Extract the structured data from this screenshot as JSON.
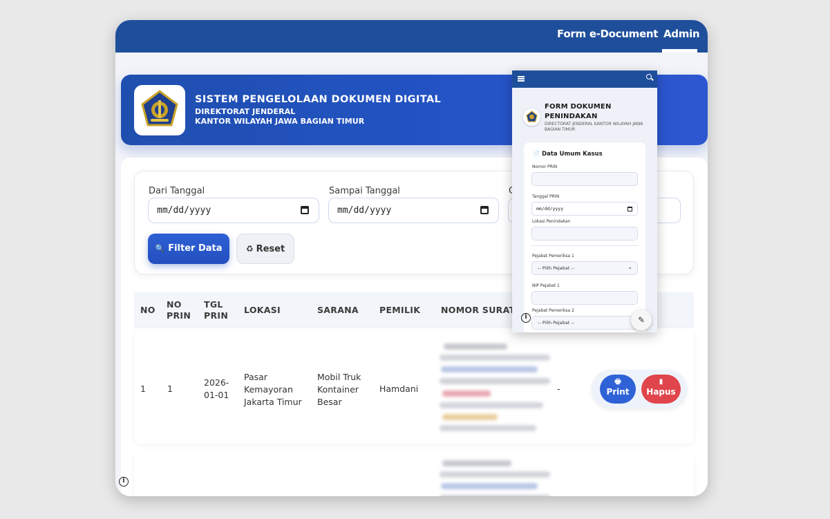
{
  "nav": {
    "form_link": "Form e-Document",
    "admin_link": "Admin"
  },
  "hero": {
    "title": "SISTEM PENGELOLAAN DOKUMEN DIGITAL",
    "subtitle_line1": "DIREKTORAT JENDERAL",
    "subtitle_line2": "KANTOR WILAYAH JAWA BAGIAN TIMUR"
  },
  "filter": {
    "from_label": "Dari Tanggal",
    "to_label": "Sampai Tanggal",
    "third_label": "C",
    "date_placeholder": "mm/dd/yyyy",
    "filter_button": "Filter Data",
    "reset_button": "Reset",
    "filter_icon": "magnifier-icon",
    "reset_icon": "recycle-icon"
  },
  "table": {
    "columns": [
      "NO",
      "NO PRIN",
      "TGL PRIN",
      "LOKASI",
      "SARANA",
      "PEMILIK",
      "NOMOR SURAT"
    ],
    "rows": [
      {
        "no": "1",
        "no_prin": "1",
        "tgl_prin": "2026-01-01",
        "lokasi": "Pasar Kemayoran Jakarta Timur",
        "sarana": "Mobil Truk Kontainer Besar",
        "pemilik": "Hamdani",
        "extra": "-",
        "print_label": "Print",
        "hapus_label": "Hapus"
      }
    ]
  },
  "phone": {
    "title": "FORM DOKUMEN PENINDAKAN",
    "subtitle": "DIRECTORAT JENDERAL KANTOR WILAYAH JAWA BAGIAN TIMUR",
    "section": "Data Umum Kasus",
    "nomor_prin_label": "Nomor PRIN",
    "tanggal_prin_label": "Tanggal PRIN",
    "date_placeholder": "mm/dd/yyyy",
    "lokasi_label": "Lokasi Penindakan",
    "pejabat1_label": "Pejabat Pemeriksa 1",
    "pejabat_option": "-- Pilih Pejabat --",
    "nip1_label": "NIP Pejabat 1",
    "pejabat2_label": "Pejabat Pemeriksa 2"
  },
  "colors": {
    "nav_bg": "#1f4f9b",
    "hero_bg": "#2353c4",
    "primary_button": "#2f62d6",
    "danger_button": "#e0454b"
  }
}
